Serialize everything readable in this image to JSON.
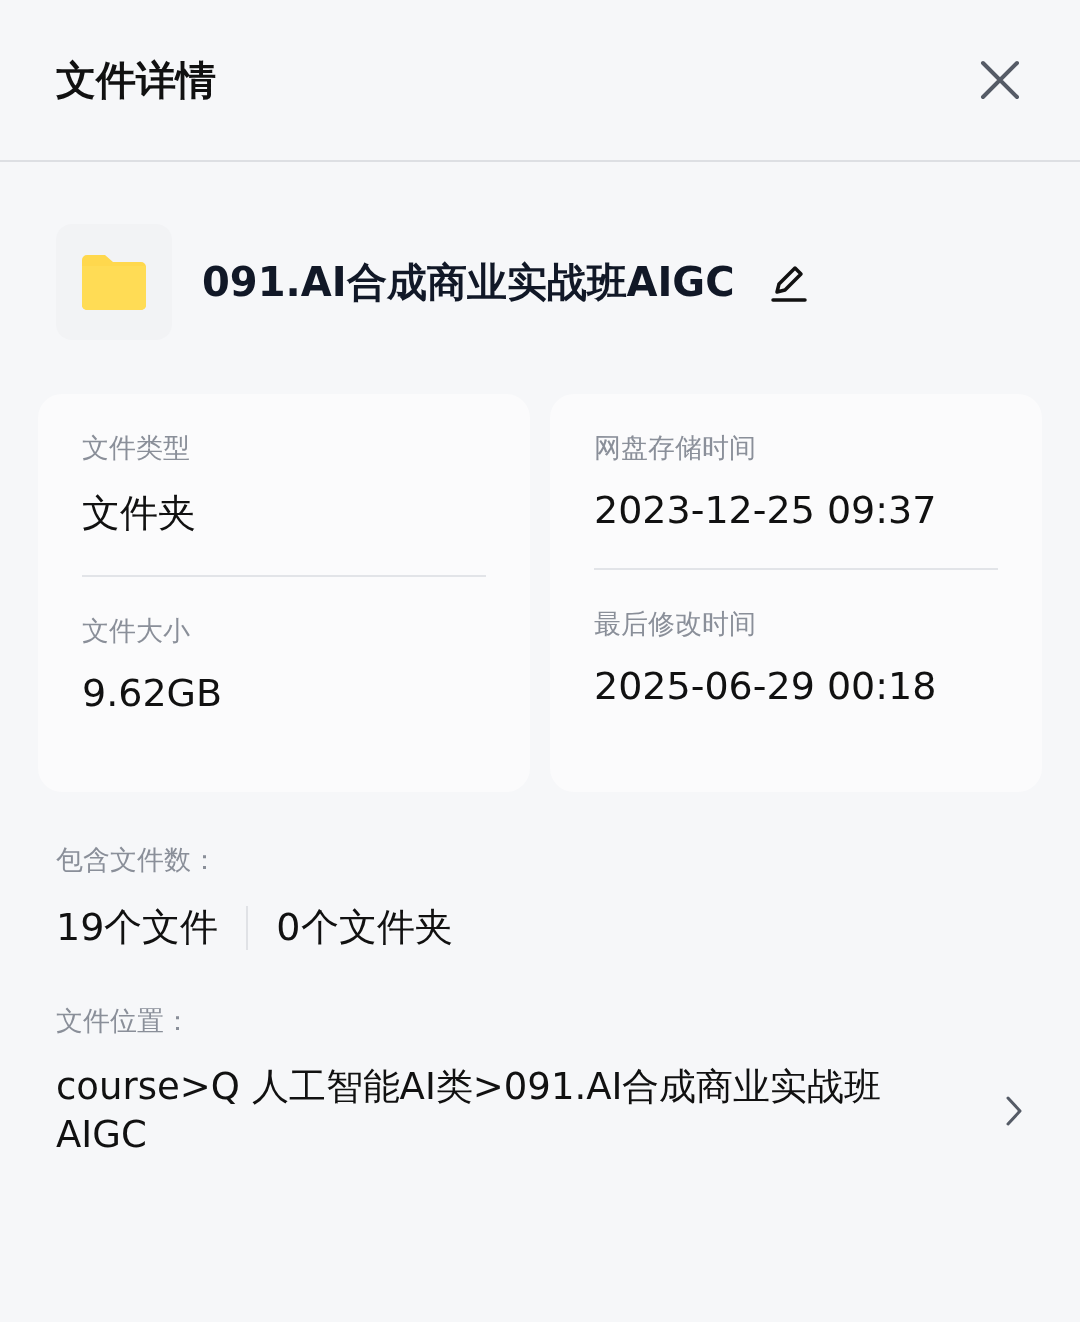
{
  "header": {
    "title": "文件详情"
  },
  "file": {
    "name": "091.AI合成商业实战班AIGC"
  },
  "cards": [
    {
      "fields": [
        {
          "label": "文件类型",
          "value": "文件夹"
        },
        {
          "label": "文件大小",
          "value": "9.62GB"
        }
      ]
    },
    {
      "fields": [
        {
          "label": "网盘存储时间",
          "value": "2023-12-25 09:37"
        },
        {
          "label": "最后修改时间",
          "value": "2025-06-29 00:18"
        }
      ]
    }
  ],
  "contents": {
    "label": "包含文件数：",
    "counts": [
      "19个文件",
      "0个文件夹"
    ]
  },
  "location": {
    "label": "文件位置：",
    "path": "course>Q 人工智能AI类>091.AI合成商业实战班AIGC"
  }
}
